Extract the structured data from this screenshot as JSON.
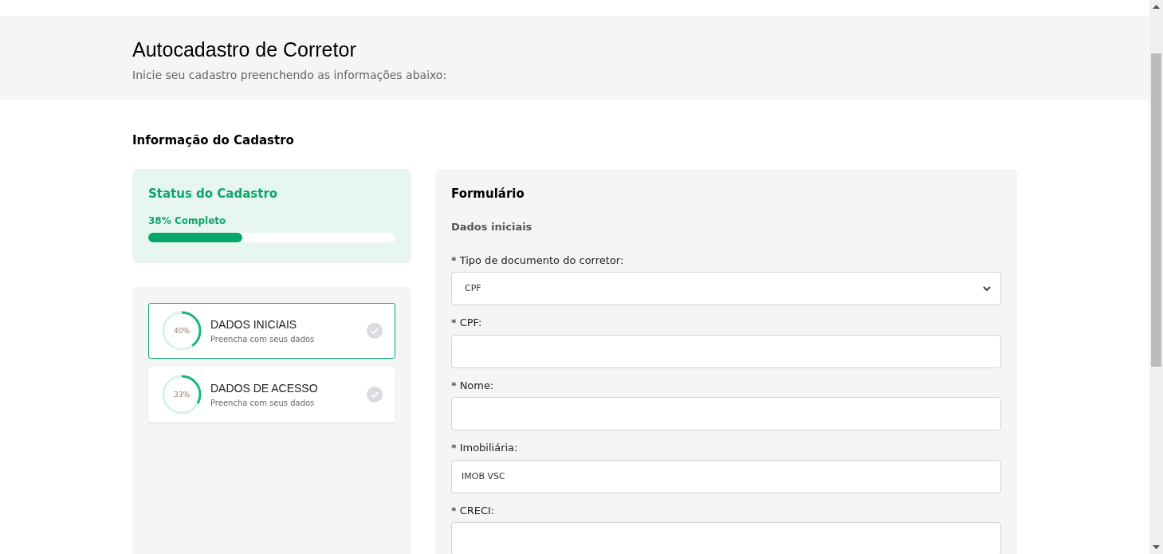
{
  "header": {
    "title": "Autocadastro de Corretor",
    "subtitle": "Inicie seu cadastro preenchendo as informações abaixo:"
  },
  "section_title": "Informação do Cadastro",
  "status": {
    "title": "Status do Cadastro",
    "reading": "38% Completo",
    "level": 0.38
  },
  "steps": [
    {
      "title": "DADOS INICIAIS",
      "subtitle": "Preencha com seus dados",
      "percent": "40%",
      "level": 0.4,
      "selected": true
    },
    {
      "title": "DADOS DE ACESSO",
      "subtitle": "Preencha com seus dados",
      "percent": "33%",
      "level": 0.33,
      "selected": false
    }
  ],
  "form": {
    "title": "Formulário",
    "subtitle": "Dados iniciais",
    "fields": [
      {
        "kind": "select",
        "label": "* Tipo de documento do corretor:",
        "value": "CPF"
      },
      {
        "kind": "text",
        "label": "* CPF:"
      },
      {
        "kind": "text",
        "label": "* Nome:"
      },
      {
        "kind": "text",
        "label": "* Imobiliária:",
        "value": "IMOB VSC"
      },
      {
        "kind": "text",
        "label": "* CRECI:"
      }
    ]
  }
}
